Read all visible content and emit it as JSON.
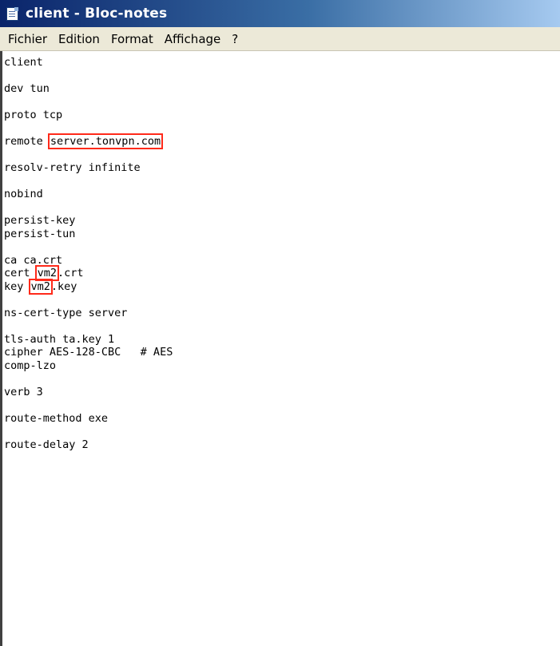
{
  "window": {
    "title": "client - Bloc-notes"
  },
  "menu": {
    "items": [
      "Fichier",
      "Edition",
      "Format",
      "Affichage",
      "?"
    ]
  },
  "editor": {
    "lines": [
      {
        "pre": "client"
      },
      {
        "pre": ""
      },
      {
        "pre": "dev tun"
      },
      {
        "pre": ""
      },
      {
        "pre": "proto tcp"
      },
      {
        "pre": ""
      },
      {
        "pre": "remote ",
        "hl": "server.tonvpn.com",
        "post": ""
      },
      {
        "pre": ""
      },
      {
        "pre": "resolv-retry infinite"
      },
      {
        "pre": ""
      },
      {
        "pre": "nobind"
      },
      {
        "pre": ""
      },
      {
        "pre": "persist-key"
      },
      {
        "pre": "persist-tun"
      },
      {
        "pre": ""
      },
      {
        "pre": "ca ca.crt"
      },
      {
        "pre": "cert ",
        "hl": "vm2",
        "post": ".crt"
      },
      {
        "pre": "key ",
        "hl": "vm2",
        "post": ".key"
      },
      {
        "pre": ""
      },
      {
        "pre": "ns-cert-type server"
      },
      {
        "pre": ""
      },
      {
        "pre": "tls-auth ta.key 1"
      },
      {
        "pre": "cipher AES-128-CBC   # AES"
      },
      {
        "pre": "comp-lzo"
      },
      {
        "pre": ""
      },
      {
        "pre": "verb 3"
      },
      {
        "pre": ""
      },
      {
        "pre": "route-method exe"
      },
      {
        "pre": ""
      },
      {
        "pre": "route-delay 2"
      }
    ]
  },
  "colors": {
    "highlight_box": "#ff2a1a",
    "titlebar_start": "#0a246a",
    "menubar_bg": "#ece9d8"
  }
}
